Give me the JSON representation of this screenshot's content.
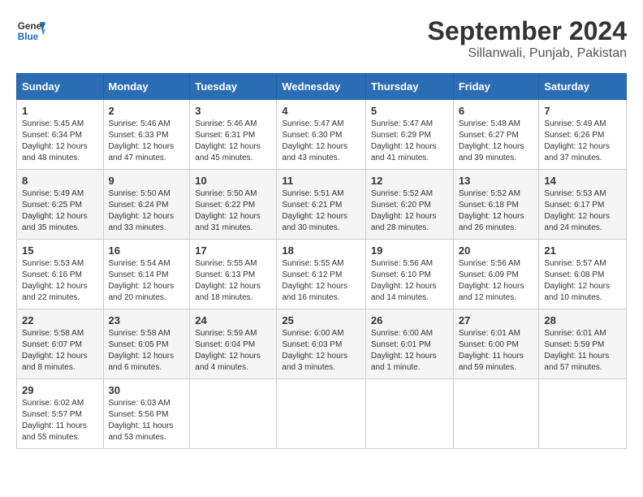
{
  "header": {
    "logo_line1": "General",
    "logo_line2": "Blue",
    "month": "September 2024",
    "location": "Sillanwali, Punjab, Pakistan"
  },
  "weekdays": [
    "Sunday",
    "Monday",
    "Tuesday",
    "Wednesday",
    "Thursday",
    "Friday",
    "Saturday"
  ],
  "weeks": [
    [
      {
        "day": 1,
        "sunrise": "5:45 AM",
        "sunset": "6:34 PM",
        "daylight": "12 hours and 48 minutes."
      },
      {
        "day": 2,
        "sunrise": "5:46 AM",
        "sunset": "6:33 PM",
        "daylight": "12 hours and 47 minutes."
      },
      {
        "day": 3,
        "sunrise": "5:46 AM",
        "sunset": "6:31 PM",
        "daylight": "12 hours and 45 minutes."
      },
      {
        "day": 4,
        "sunrise": "5:47 AM",
        "sunset": "6:30 PM",
        "daylight": "12 hours and 43 minutes."
      },
      {
        "day": 5,
        "sunrise": "5:47 AM",
        "sunset": "6:29 PM",
        "daylight": "12 hours and 41 minutes."
      },
      {
        "day": 6,
        "sunrise": "5:48 AM",
        "sunset": "6:27 PM",
        "daylight": "12 hours and 39 minutes."
      },
      {
        "day": 7,
        "sunrise": "5:49 AM",
        "sunset": "6:26 PM",
        "daylight": "12 hours and 37 minutes."
      }
    ],
    [
      {
        "day": 8,
        "sunrise": "5:49 AM",
        "sunset": "6:25 PM",
        "daylight": "12 hours and 35 minutes."
      },
      {
        "day": 9,
        "sunrise": "5:50 AM",
        "sunset": "6:24 PM",
        "daylight": "12 hours and 33 minutes."
      },
      {
        "day": 10,
        "sunrise": "5:50 AM",
        "sunset": "6:22 PM",
        "daylight": "12 hours and 31 minutes."
      },
      {
        "day": 11,
        "sunrise": "5:51 AM",
        "sunset": "6:21 PM",
        "daylight": "12 hours and 30 minutes."
      },
      {
        "day": 12,
        "sunrise": "5:52 AM",
        "sunset": "6:20 PM",
        "daylight": "12 hours and 28 minutes."
      },
      {
        "day": 13,
        "sunrise": "5:52 AM",
        "sunset": "6:18 PM",
        "daylight": "12 hours and 26 minutes."
      },
      {
        "day": 14,
        "sunrise": "5:53 AM",
        "sunset": "6:17 PM",
        "daylight": "12 hours and 24 minutes."
      }
    ],
    [
      {
        "day": 15,
        "sunrise": "5:53 AM",
        "sunset": "6:16 PM",
        "daylight": "12 hours and 22 minutes."
      },
      {
        "day": 16,
        "sunrise": "5:54 AM",
        "sunset": "6:14 PM",
        "daylight": "12 hours and 20 minutes."
      },
      {
        "day": 17,
        "sunrise": "5:55 AM",
        "sunset": "6:13 PM",
        "daylight": "12 hours and 18 minutes."
      },
      {
        "day": 18,
        "sunrise": "5:55 AM",
        "sunset": "6:12 PM",
        "daylight": "12 hours and 16 minutes."
      },
      {
        "day": 19,
        "sunrise": "5:56 AM",
        "sunset": "6:10 PM",
        "daylight": "12 hours and 14 minutes."
      },
      {
        "day": 20,
        "sunrise": "5:56 AM",
        "sunset": "6:09 PM",
        "daylight": "12 hours and 12 minutes."
      },
      {
        "day": 21,
        "sunrise": "5:57 AM",
        "sunset": "6:08 PM",
        "daylight": "12 hours and 10 minutes."
      }
    ],
    [
      {
        "day": 22,
        "sunrise": "5:58 AM",
        "sunset": "6:07 PM",
        "daylight": "12 hours and 8 minutes."
      },
      {
        "day": 23,
        "sunrise": "5:58 AM",
        "sunset": "6:05 PM",
        "daylight": "12 hours and 6 minutes."
      },
      {
        "day": 24,
        "sunrise": "5:59 AM",
        "sunset": "6:04 PM",
        "daylight": "12 hours and 4 minutes."
      },
      {
        "day": 25,
        "sunrise": "6:00 AM",
        "sunset": "6:03 PM",
        "daylight": "12 hours and 3 minutes."
      },
      {
        "day": 26,
        "sunrise": "6:00 AM",
        "sunset": "6:01 PM",
        "daylight": "12 hours and 1 minute."
      },
      {
        "day": 27,
        "sunrise": "6:01 AM",
        "sunset": "6:00 PM",
        "daylight": "11 hours and 59 minutes."
      },
      {
        "day": 28,
        "sunrise": "6:01 AM",
        "sunset": "5:59 PM",
        "daylight": "11 hours and 57 minutes."
      }
    ],
    [
      {
        "day": 29,
        "sunrise": "6:02 AM",
        "sunset": "5:57 PM",
        "daylight": "11 hours and 55 minutes."
      },
      {
        "day": 30,
        "sunrise": "6:03 AM",
        "sunset": "5:56 PM",
        "daylight": "11 hours and 53 minutes."
      },
      null,
      null,
      null,
      null,
      null
    ]
  ]
}
